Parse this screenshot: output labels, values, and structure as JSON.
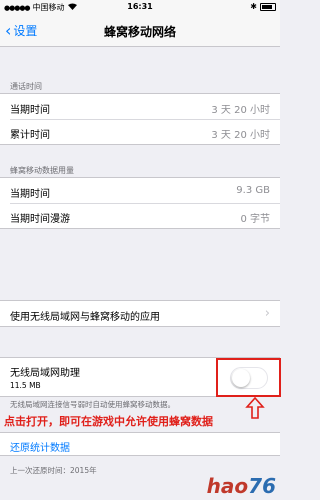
{
  "status_bar": {
    "carrier": "中国移动",
    "time": "16:31"
  },
  "nav": {
    "back_label": "设置",
    "title": "蜂窝移动网络"
  },
  "call_time": {
    "header": "通话时间",
    "rows": [
      {
        "label": "当期时间",
        "value": "3 天 20 小时"
      },
      {
        "label": "累计时间",
        "value": "3 天 20 小时"
      }
    ]
  },
  "data_usage": {
    "header": "蜂窝移动数据用量",
    "rows": [
      {
        "label": "当期时间",
        "value": "9.3 GB"
      },
      {
        "label": "当期时间漫游",
        "value": "0 字节"
      }
    ]
  },
  "apps_row": {
    "label": "使用无线局域网与蜂窝移动的应用"
  },
  "wlan_assist": {
    "label": "无线局域网助理",
    "size": "11.5 MB",
    "enabled": false
  },
  "footer_note": "无线局域网连接信号弱时自动使用蜂窝移动数据。",
  "annotation": "点击打开，即可在游戏中允许使用蜂窝数据",
  "reset_link": "还原统计数据",
  "last_reset": "上一次还原时间：2015年",
  "watermark": {
    "text": "hao",
    "num": "76"
  },
  "colors": {
    "accent": "#007aff",
    "annotation": "#e0201a"
  }
}
